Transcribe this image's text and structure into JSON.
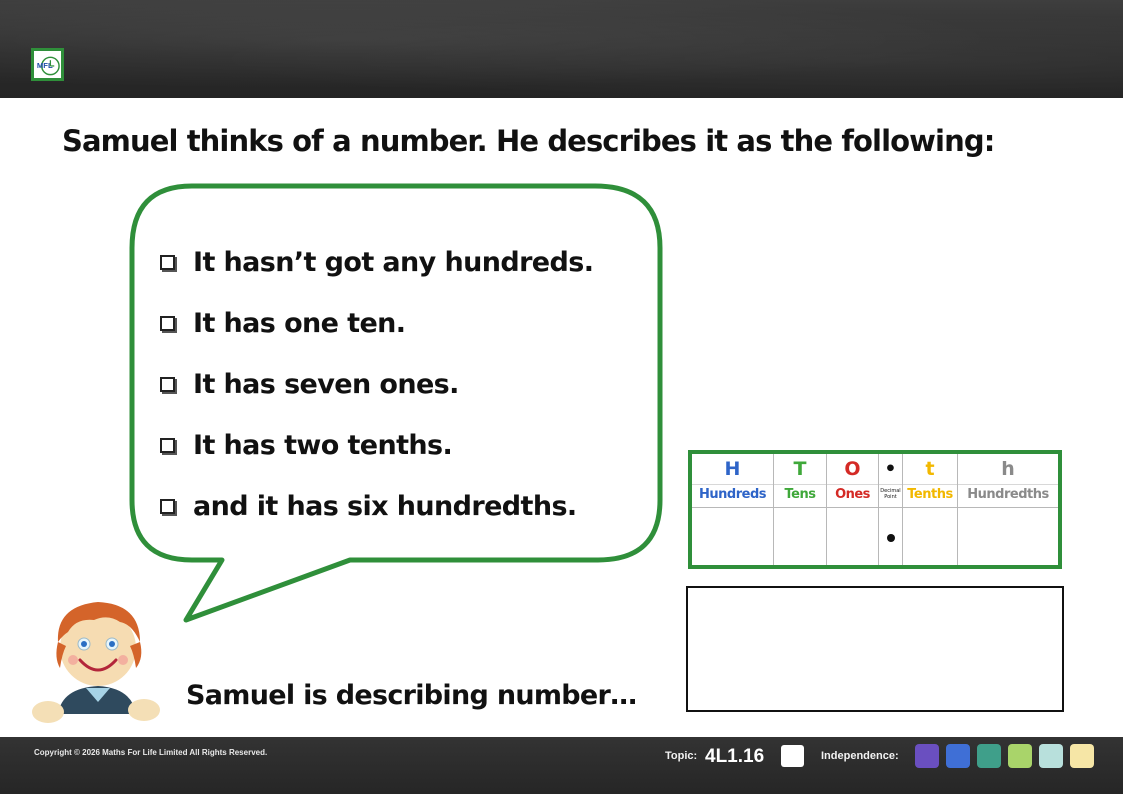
{
  "header": {
    "logo_text": "MFL"
  },
  "question": "Samuel thinks of a number.  He describes it as the following:",
  "clues": [
    "It hasn’t got any hundreds.",
    "It has one ten.",
    "It has seven ones.",
    "It has two tenths.",
    "and it has six hundredths."
  ],
  "place_value_table": {
    "columns": [
      {
        "letter": "H",
        "word": "Hundreds",
        "color": "#2e64c8"
      },
      {
        "letter": "T",
        "word": "Tens",
        "color": "#3fa83a"
      },
      {
        "letter": "O",
        "word": "Ones",
        "color": "#d42a25"
      },
      {
        "letter": "•",
        "word": "Decimal Point",
        "color": "#111111"
      },
      {
        "letter": "t",
        "word": "Tenths",
        "color": "#f2b800"
      },
      {
        "letter": "h",
        "word": "Hundredths",
        "color": "#8a8a8a"
      }
    ]
  },
  "prompt": "Samuel is describing number…",
  "footer": {
    "copyright": "Copyright © 2026 Maths For Life Limited All Rights Reserved.",
    "topic_label": "Topic:",
    "topic_code": "4L1.16",
    "independence_label": "Independence:",
    "independence_colors": [
      "#6a4fc0",
      "#3f6fd6",
      "#3f9f8a",
      "#a9d46a",
      "#b8e0dc",
      "#f6e6a6"
    ]
  },
  "icons": {
    "logo": "mfl-logo-icon",
    "checkbox": "checkbox-icon",
    "character": "samuel-character-icon"
  }
}
